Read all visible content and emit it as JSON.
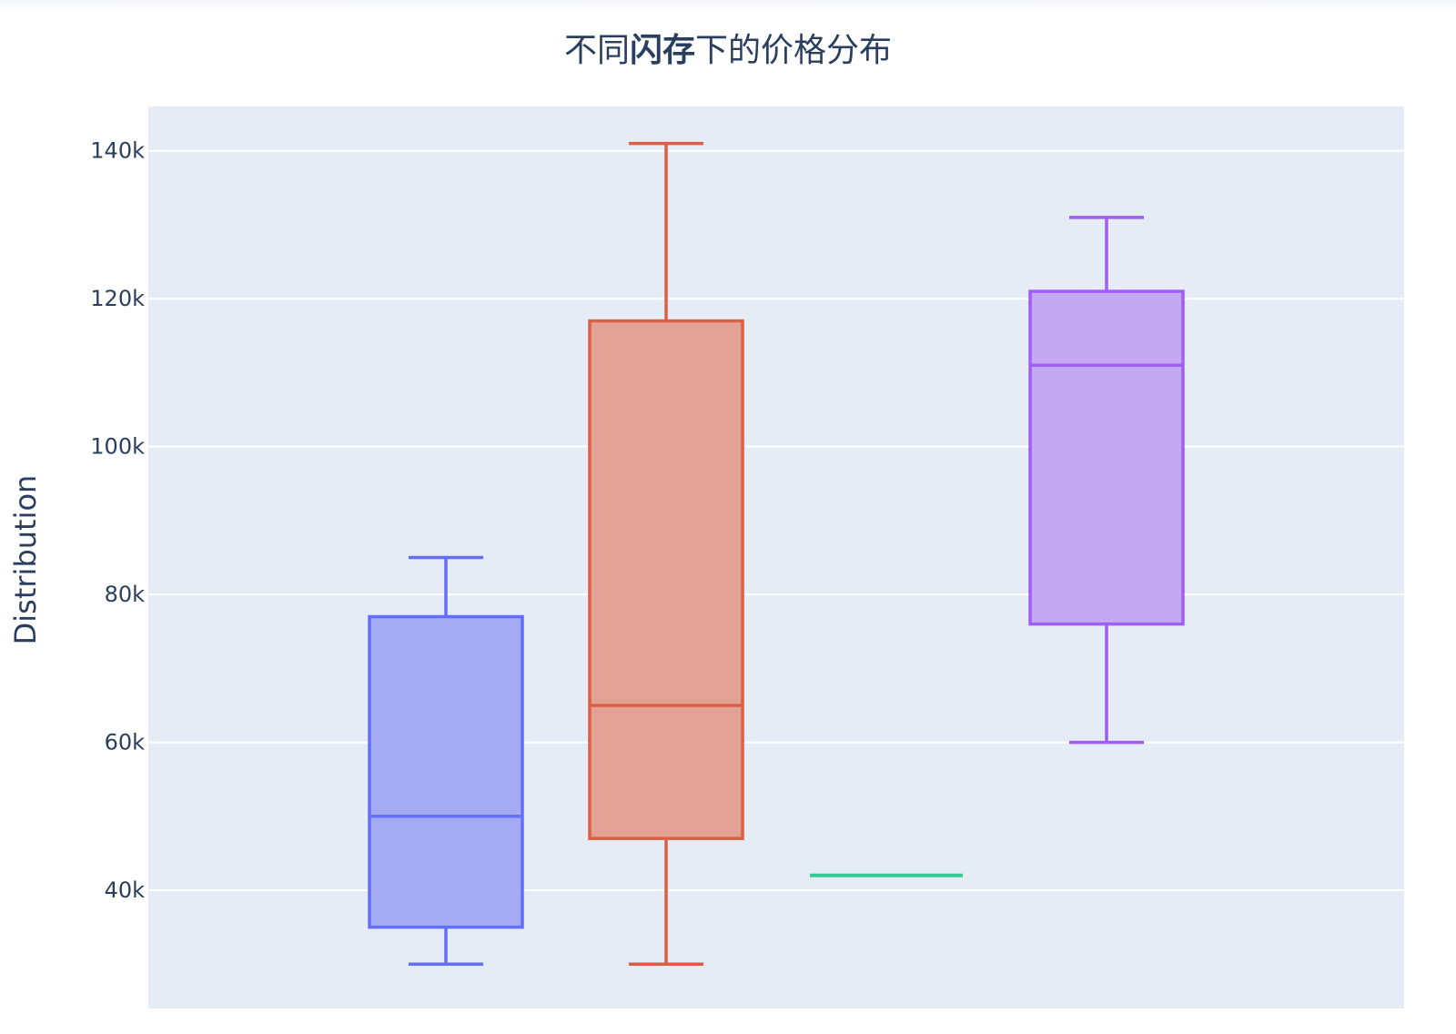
{
  "chart_data": {
    "type": "box",
    "title_parts": [
      {
        "text": "不同",
        "bold": false
      },
      {
        "text": "闪存",
        "bold": true
      },
      {
        "text": "下的价格分布",
        "bold": false
      }
    ],
    "xlabel": "",
    "ylabel": "Distribution",
    "ylim": [
      24000,
      146000
    ],
    "yticks": [
      40000,
      60000,
      80000,
      100000,
      120000,
      140000
    ],
    "ytick_labels": [
      "40k",
      "60k",
      "80k",
      "100k",
      "120k",
      "140k"
    ],
    "grid": true,
    "background": "#e5ecf6",
    "series": [
      {
        "color": "#636efa",
        "fill": "#a5abf3",
        "min": 30000,
        "q1": 35000,
        "median": 50000,
        "q3": 77000,
        "max": 85000
      },
      {
        "color": "#dc5f45",
        "fill": "#e3a296",
        "min": 30000,
        "q1": 47000,
        "median": 65000,
        "q3": 117000,
        "max": 141000
      },
      {
        "color": "#34c993",
        "fill": "#9be4c9",
        "min": 42000,
        "q1": 42000,
        "median": 42000,
        "q3": 42000,
        "max": 42000
      },
      {
        "color": "#a05ef5",
        "fill": "#c4a8f1",
        "min": 60000,
        "q1": 76000,
        "median": 111000,
        "q3": 121000,
        "max": 131000
      }
    ]
  }
}
